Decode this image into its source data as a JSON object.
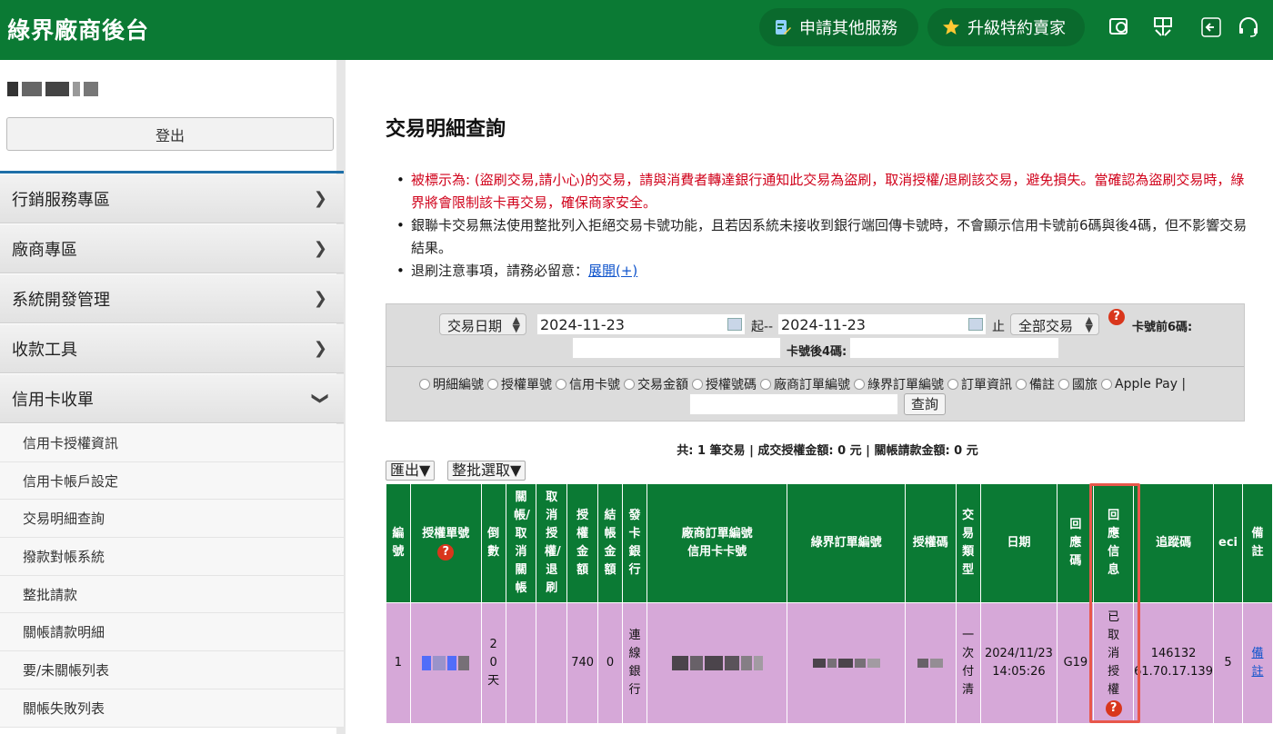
{
  "header": {
    "brand": "綠界廠商後台",
    "apply_label": "申請其他服務",
    "upgrade_label": "升級特約賣家",
    "colors": {
      "bar": "#0b7a34",
      "pill": "#0a6a2d"
    }
  },
  "sidebar": {
    "logout_label": "登出",
    "menu": [
      {
        "label": "行銷服務專區",
        "icon": "chevron-right-icon"
      },
      {
        "label": "廠商專區",
        "icon": "chevron-right-icon"
      },
      {
        "label": "系統開發管理",
        "icon": "chevron-right-icon"
      },
      {
        "label": "收款工具",
        "icon": "chevron-right-icon"
      },
      {
        "label": "信用卡收單",
        "icon": "chevron-down-icon"
      }
    ],
    "submenu": [
      "信用卡授權資訊",
      "信用卡帳戶設定",
      "交易明細查詢",
      "撥款對帳系統",
      "整批請款",
      "關帳請款明細",
      "要/未關帳列表",
      "關帳失敗列表"
    ]
  },
  "main": {
    "title": "交易明細查詢",
    "notes": {
      "warning": "被標示為: (盜刷交易,請小心)的交易，請與消費者轉達銀行通知此交易為盜刷，取消授權/退刷該交易，避免損失。當確認為盜刷交易時，綠界將會限制該卡再交易，確保商家安全。",
      "unionpay": "銀聯卡交易無法使用整批列入拒絕交易卡號功能，且若因系統未接收到銀行端回傳卡號時，不會顯示信用卡號前6碼與後4碼，但不影響交易結果。",
      "refund_prefix": "退刷注意事項，請務必留意：",
      "refund_link": "展開(+)"
    },
    "filter": {
      "date_type": "交易日期",
      "start_date": "2024-11-23",
      "from_label": "起--",
      "end_date": "2024-11-23",
      "to_label": "止",
      "trade_type": "全部交易",
      "card_first6_label": "卡號前6碼:",
      "card_last4_label": "卡號後4碼:",
      "radios": [
        "明細編號",
        "授權單號",
        "信用卡號",
        "交易金額",
        "授權號碼",
        "廠商訂單編號",
        "綠界訂單編號",
        "訂單資訊",
        "備註",
        "國旅",
        "Apple Pay |"
      ],
      "search_label": "查詢"
    },
    "summary": "共: 1 筆交易 | 成交授權金額: 0 元 | 關帳請款金額: 0 元",
    "export_label": "匯出▼",
    "batch_label": "整批選取▼",
    "table": {
      "headers": {
        "no": "編號",
        "auth_no": "授權單號",
        "countdown": "倒數",
        "close_cancel": "關帳/取消關帳",
        "cancel_refund": "取消授權/退刷",
        "auth_amount": "授權金額",
        "settle_amount": "結帳金額",
        "issuer": "發卡銀行",
        "merchant_order": "廠商訂單編號",
        "card_no": "信用卡卡號",
        "ecpay_order": "綠界訂單編號",
        "auth_code": "授權碼",
        "trade_type": "交易類型",
        "date": "日期",
        "resp_code": "回應碼",
        "resp_msg": "回應信息",
        "trace": "追蹤碼",
        "eci": "eci",
        "remark": "備註"
      },
      "row": {
        "no": "1",
        "countdown": "20天",
        "auth_amount": "740",
        "settle_amount": "0",
        "issuer": "連線銀行",
        "trade_type": "一次付清",
        "date": "2024/11/23",
        "time": "14:05:26",
        "resp_code": "G19",
        "resp_msg": "已取消授權",
        "trace_1": "146132",
        "trace_2": "61.70.17.139",
        "eci": "5",
        "remark": "備註",
        "row_color": "#d6a8d8"
      }
    }
  }
}
